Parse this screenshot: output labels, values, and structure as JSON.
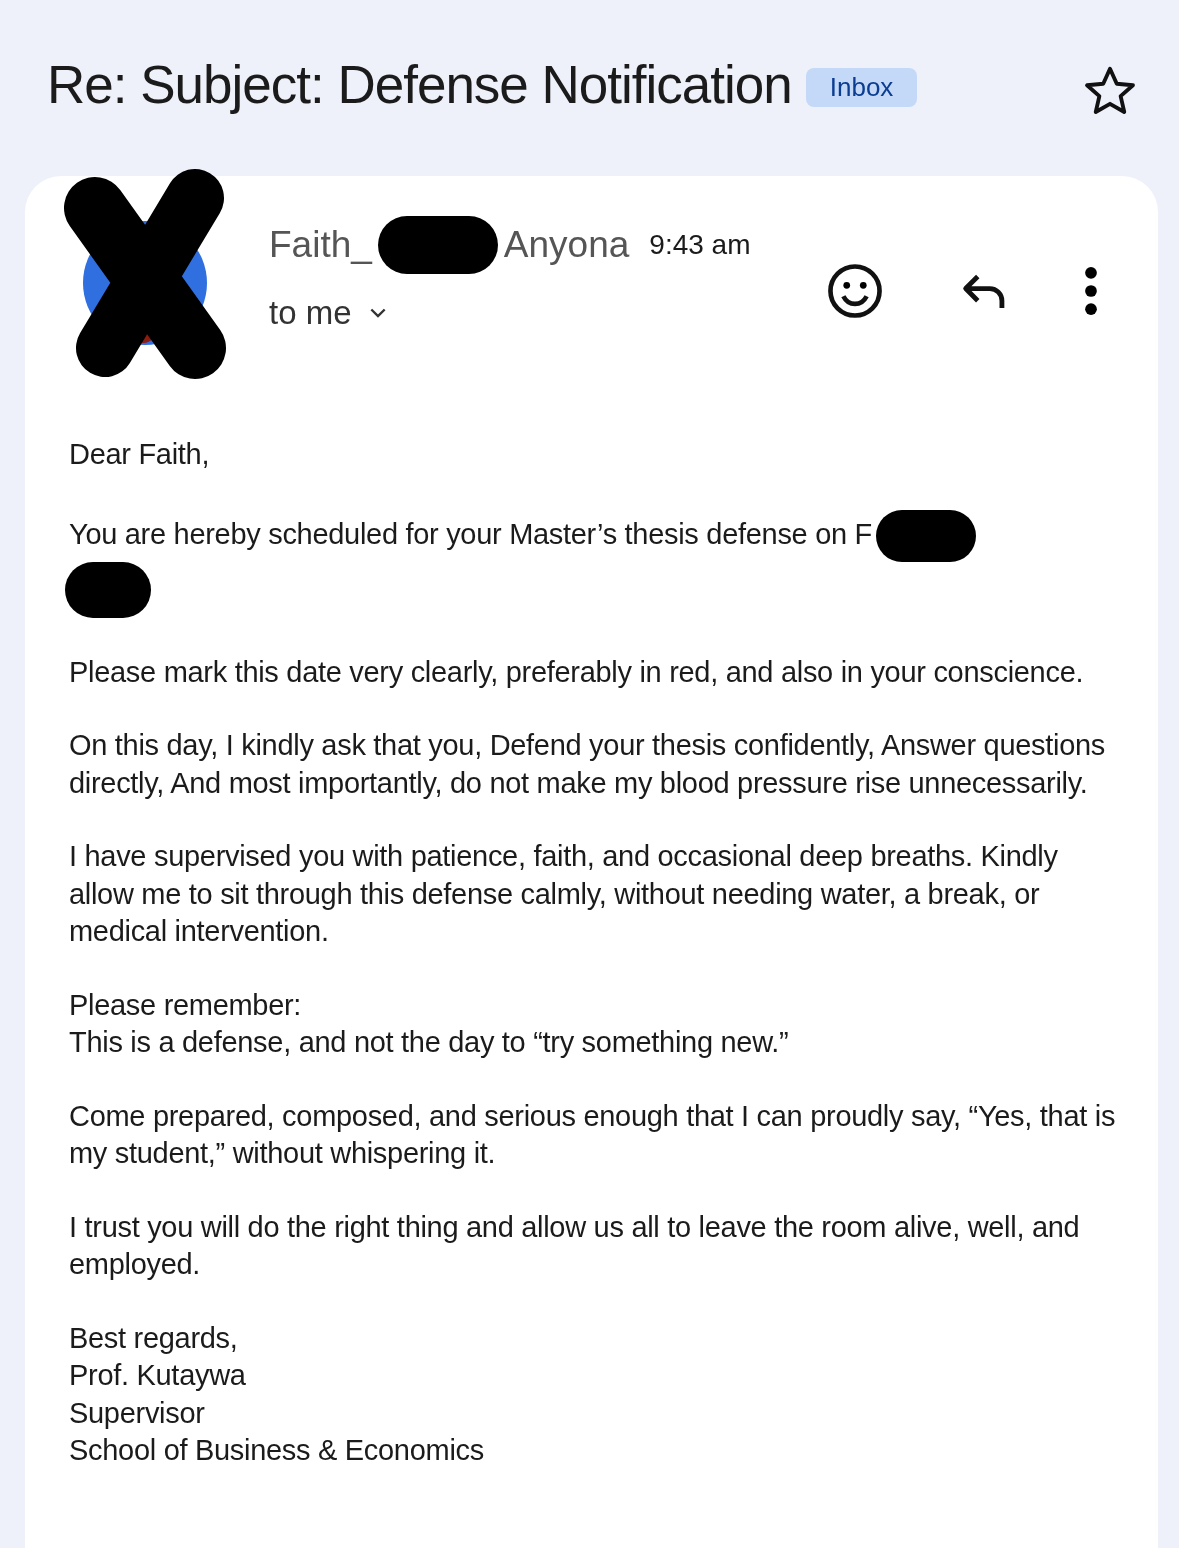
{
  "subject": "Re: Subject: Defense Notification",
  "label": "Inbox",
  "starred": false,
  "sender": {
    "name_parts": [
      "Faith_",
      "Anyona"
    ],
    "time": "9:43 am",
    "recipient": "to me"
  },
  "body": [
    [
      "Dear Faith,"
    ],
    [
      "You are hereby scheduled for your Master’s thesis defense on F"
    ],
    [
      "Please mark this date very clearly, preferably in red, and also in your conscience."
    ],
    [
      "On this day, I kindly ask that you, Defend your thesis confidently, Answer questions directly, And most importantly, do not make my blood pressure rise unnecessarily."
    ],
    [
      "I have supervised you with patience, faith, and occasional deep breaths. Kindly allow me to sit through this defense calmly, without needing water, a break, or medical intervention."
    ],
    [
      "Please remember:",
      "This is a defense, and not the day to “try something new.”"
    ],
    [
      "Come prepared, composed, and serious enough that I can proudly say, “Yes, that is my student,” without whispering it."
    ],
    [
      "I trust you will do the right thing and allow us all to leave the room alive, well, and employed."
    ],
    [
      "Best regards,",
      "Prof. Kutaywa",
      "Supervisor",
      "School of Business & Economics"
    ]
  ]
}
